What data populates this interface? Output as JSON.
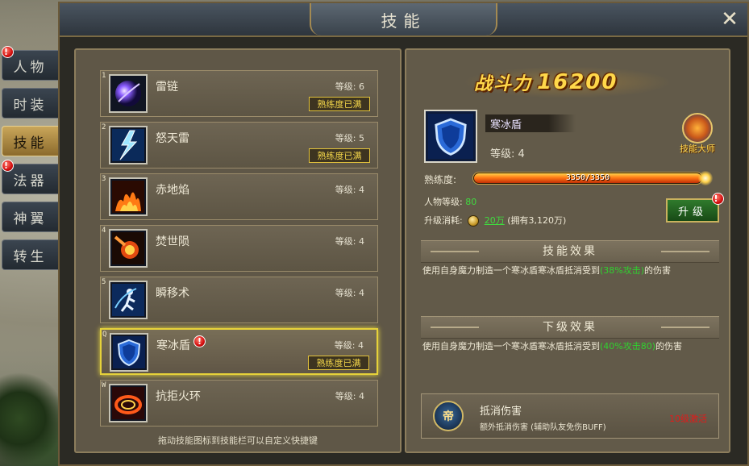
{
  "window": {
    "title": "技能",
    "close_label": "✕"
  },
  "side_tabs": [
    {
      "label": "人物",
      "alert": true,
      "active": false
    },
    {
      "label": "时装",
      "alert": false,
      "active": false
    },
    {
      "label": "技能",
      "alert": false,
      "active": true
    },
    {
      "label": "法器",
      "alert": true,
      "active": false
    },
    {
      "label": "神翼",
      "alert": false,
      "active": false
    },
    {
      "label": "转生",
      "alert": false,
      "active": false
    }
  ],
  "alert_glyph": "!",
  "skills": [
    {
      "slot": "1",
      "name": "雷链",
      "level": "等级: 6",
      "mastery": "熟练度已满",
      "icon": "purple-orb-icon"
    },
    {
      "slot": "2",
      "name": "怒天雷",
      "level": "等级: 5",
      "mastery": "熟练度已满",
      "icon": "lightning-icon"
    },
    {
      "slot": "3",
      "name": "赤地焰",
      "level": "等级: 4",
      "mastery": "",
      "icon": "fire-icon"
    },
    {
      "slot": "4",
      "name": "焚世陨",
      "level": "等级: 4",
      "mastery": "",
      "icon": "meteor-icon"
    },
    {
      "slot": "5",
      "name": "瞬移术",
      "level": "等级: 4",
      "mastery": "",
      "icon": "teleport-icon"
    },
    {
      "slot": "Q",
      "name": "寒冰盾",
      "level": "等级: 4",
      "mastery": "熟练度已满",
      "icon": "shield-icon",
      "selected": true,
      "alert": true
    },
    {
      "slot": "W",
      "name": "抗拒火环",
      "level": "等级: 4",
      "mastery": "",
      "icon": "fire-ring-icon"
    }
  ],
  "left_footer": "拖动技能图标到技能栏可以自定义快捷键",
  "detail": {
    "power_label": "战斗力",
    "power_value": "16200",
    "skill_name": "寒冰盾",
    "skill_level": "等级: 4",
    "master_badge": "技能大师",
    "proficiency_label": "熟练度:",
    "proficiency_text": "3350/3350",
    "proficiency_fraction": 1.0,
    "char_level_label": "人物等级:",
    "char_level_value": "80",
    "cost_label": "升级消耗:",
    "cost_value": "20万",
    "cost_owned": "(拥有3,120万)",
    "upgrade_label": "升级",
    "effect_header": "技能效果",
    "effect_pre": "使用自身魔力制造一个寒冰盾寒冰盾抵消受到",
    "effect_highlight": "(38%攻击)",
    "effect_post": "的伤害",
    "next_header": "下级效果",
    "next_pre": "使用自身魔力制造一个寒冰盾寒冰盾抵消受到",
    "next_highlight": "(40%攻击80)",
    "next_post": "的伤害",
    "bonus_icon_glyph": "帝",
    "bonus_title": "抵消伤害",
    "bonus_desc": "额外抵消伤害 (辅助队友免伤BUFF)",
    "bonus_unlock": "10级激活"
  },
  "colors": {
    "accent_gold": "#ffd84a",
    "highlight_green": "#2fd22f",
    "alert_red": "#d40f0f",
    "selected_border": "#e6d23a"
  }
}
